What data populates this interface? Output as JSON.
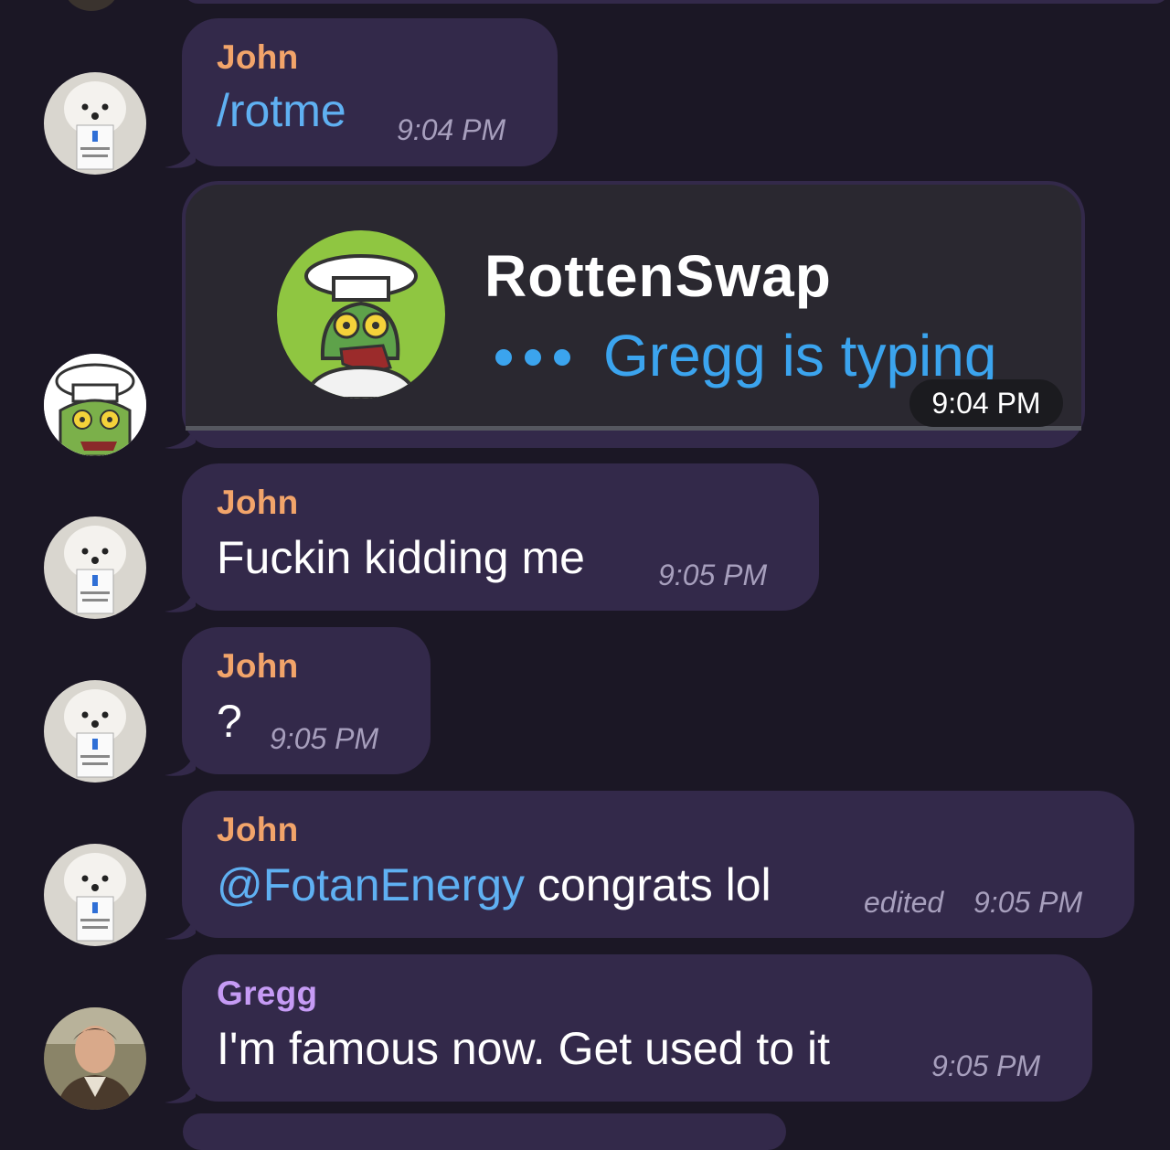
{
  "colors": {
    "background": "#1b1725",
    "bubble": "#33294a",
    "john": "#f2a46a",
    "gregg": "#c69bf5",
    "mention": "#5fb0f2",
    "typing": "#3ba4ee"
  },
  "messages": [
    {
      "sender": "John",
      "text": "/rotme",
      "time": "9:04 PM",
      "avatar": "dog-avatar"
    },
    {
      "card_title": "RottenSwap",
      "card_status": "Gregg is typing",
      "time": "9:04 PM",
      "avatar": "chef-zombie-avatar"
    },
    {
      "sender": "John",
      "text": "Fuckin kidding me",
      "time": "9:05 PM",
      "avatar": "dog-avatar"
    },
    {
      "sender": "John",
      "text": "?",
      "time": "9:05 PM",
      "avatar": "dog-avatar"
    },
    {
      "sender": "John",
      "mention": "@FotanEnergy",
      "text": " congrats lol",
      "edited": "edited",
      "time": "9:05 PM",
      "avatar": "dog-avatar"
    },
    {
      "sender": "Gregg",
      "text": "I'm famous now. Get used to it",
      "time": "9:05 PM",
      "avatar": "man-avatar"
    }
  ]
}
